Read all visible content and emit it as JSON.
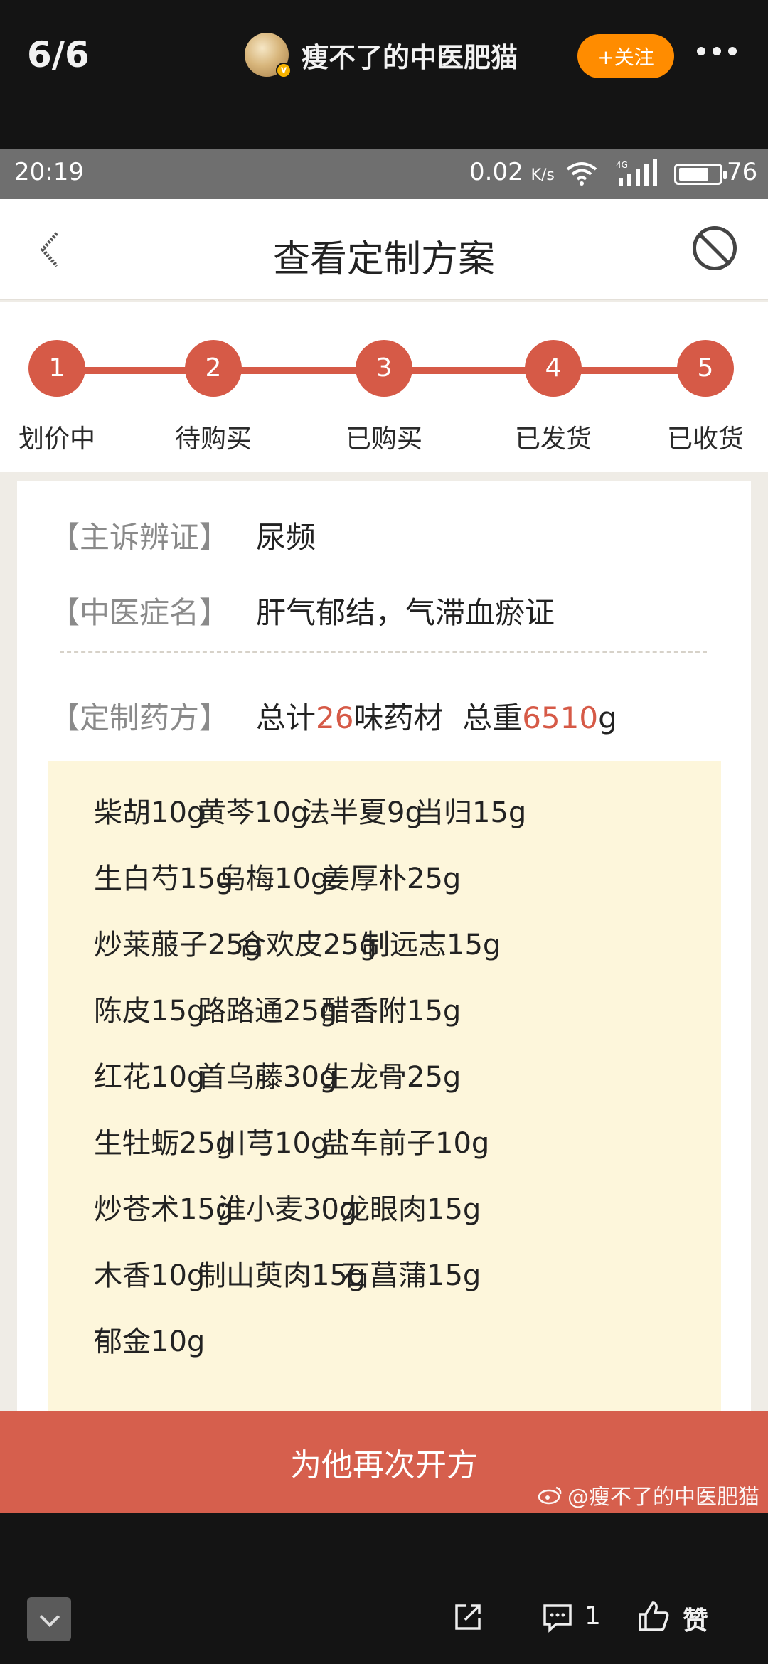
{
  "viewer": {
    "counter": "6/6",
    "author": "瘦不了的中医肥猫",
    "follow_label": "+关注",
    "comment_count": "1",
    "like_label": "赞"
  },
  "statusbar": {
    "time": "20:19",
    "speed_value": "0.02",
    "speed_unit": "K/s",
    "battery": "76",
    "battery_level_percent": 76
  },
  "header": {
    "title": "查看定制方案"
  },
  "steps": [
    {
      "number": "1",
      "label": "划价中"
    },
    {
      "number": "2",
      "label": "待购买"
    },
    {
      "number": "3",
      "label": "已购买"
    },
    {
      "number": "4",
      "label": "已发货"
    },
    {
      "number": "5",
      "label": "已收货"
    }
  ],
  "diagnosis": {
    "complaint_label": "【主诉辨证】",
    "complaint": "尿频",
    "syndrome_label": "【中医症名】",
    "syndrome": "肝气郁结，气滞血瘀证"
  },
  "prescription": {
    "label": "【定制药方】",
    "total_prefix": "总计",
    "count": "26",
    "count_suffix": "味药材",
    "weight_prefix": "总重",
    "weight": "6510",
    "weight_unit": "g"
  },
  "herbs": [
    [
      "柴胡10g",
      "黄芩10g",
      "法半夏9g",
      "当归15g"
    ],
    [
      "生白芍15g",
      "乌梅10g",
      "姜厚朴25g"
    ],
    [
      "炒莱菔子25g",
      "合欢皮25g",
      "制远志15g"
    ],
    [
      "陈皮15g",
      "路路通25g",
      "醋香附15g"
    ],
    [
      "红花10g",
      "首乌藤30g",
      "生龙骨25g"
    ],
    [
      "生牡蛎25g",
      "川芎10g",
      "盐车前子10g"
    ],
    [
      "炒苍术15g",
      "淮小麦30g",
      "龙眼肉15g"
    ],
    [
      "木香10g",
      "制山萸肉15g",
      "石菖蒲15g"
    ],
    [
      "郁金10g"
    ]
  ],
  "action": {
    "label": "为他再次开方"
  },
  "watermark": "@瘦不了的中医肥猫"
}
